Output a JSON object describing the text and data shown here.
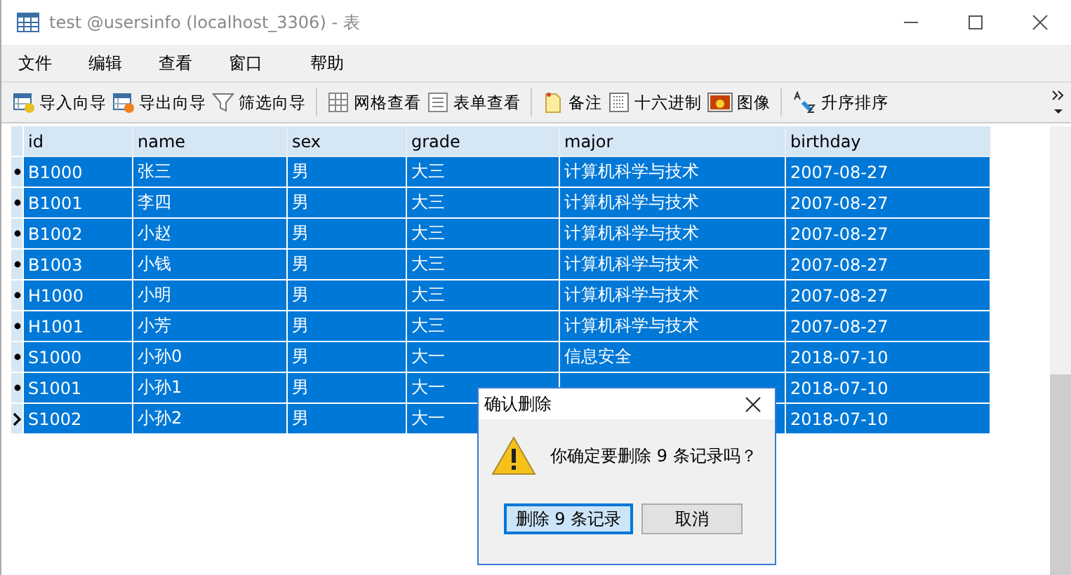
{
  "window": {
    "title": "test @usersinfo (localhost_3306) - 表"
  },
  "menu": [
    "文件",
    "编辑",
    "查看",
    "窗口",
    "帮助"
  ],
  "toolbar": [
    {
      "kind": "import",
      "label": "导入向导"
    },
    {
      "kind": "export",
      "label": "导出向导"
    },
    {
      "kind": "filter",
      "label": "筛选向导"
    },
    {
      "kind": "sep"
    },
    {
      "kind": "grid",
      "label": "网格查看"
    },
    {
      "kind": "form",
      "label": "表单查看"
    },
    {
      "kind": "sep"
    },
    {
      "kind": "note",
      "label": "备注"
    },
    {
      "kind": "hex",
      "label": "十六进制"
    },
    {
      "kind": "image",
      "label": "图像"
    },
    {
      "kind": "sep"
    },
    {
      "kind": "sort",
      "label": "升序排序"
    }
  ],
  "table": {
    "columns": [
      "id",
      "name",
      "sex",
      "grade",
      "major",
      "birthday"
    ],
    "rows": [
      {
        "selected": true,
        "current": false,
        "cells": [
          "B1000",
          "张三",
          "男",
          "大三",
          "计算机科学与技术",
          "2007-08-27"
        ]
      },
      {
        "selected": true,
        "current": false,
        "cells": [
          "B1001",
          "李四",
          "男",
          "大三",
          "计算机科学与技术",
          "2007-08-27"
        ]
      },
      {
        "selected": true,
        "current": false,
        "cells": [
          "B1002",
          "小赵",
          "男",
          "大三",
          "计算机科学与技术",
          "2007-08-27"
        ]
      },
      {
        "selected": true,
        "current": false,
        "cells": [
          "B1003",
          "小钱",
          "男",
          "大三",
          "计算机科学与技术",
          "2007-08-27"
        ]
      },
      {
        "selected": true,
        "current": false,
        "cells": [
          "H1000",
          "小明",
          "男",
          "大三",
          "计算机科学与技术",
          "2007-08-27"
        ]
      },
      {
        "selected": true,
        "current": false,
        "cells": [
          "H1001",
          "小芳",
          "男",
          "大三",
          "计算机科学与技术",
          "2007-08-27"
        ]
      },
      {
        "selected": true,
        "current": false,
        "cells": [
          "S1000",
          "小孙0",
          "男",
          "大一",
          "信息安全",
          "2018-07-10"
        ]
      },
      {
        "selected": true,
        "current": false,
        "cells": [
          "S1001",
          "小孙1",
          "男",
          "大一",
          null,
          "2018-07-10"
        ]
      },
      {
        "selected": true,
        "current": true,
        "cells": [
          "S1002",
          "小孙2",
          "男",
          "大一",
          null,
          "2018-07-10"
        ]
      }
    ]
  },
  "dialog": {
    "title": "确认删除",
    "message": "你确定要删除 9 条记录吗？",
    "buttons": [
      {
        "label": "删除 9 条记录",
        "default": true
      },
      {
        "label": "取消",
        "default": false
      }
    ]
  }
}
